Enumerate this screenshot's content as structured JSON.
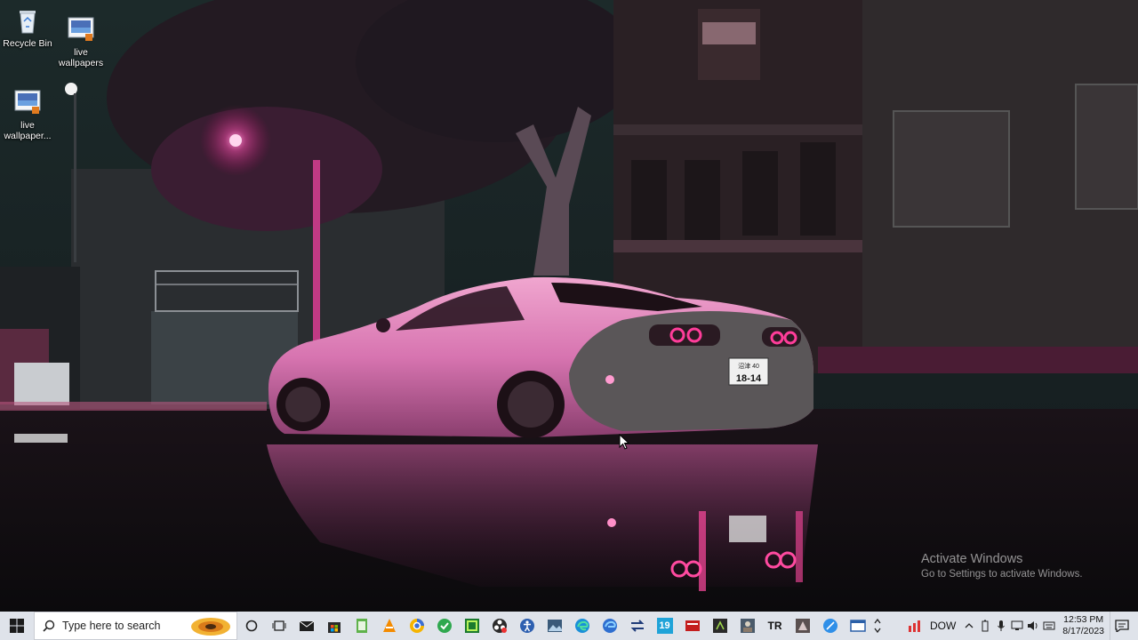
{
  "desktop": {
    "icons": [
      {
        "label": "Recycle Bin",
        "icon": "recycle-bin-icon"
      },
      {
        "label": "live wallpapers",
        "icon": "wallpaper-file-icon"
      },
      {
        "label": "live wallpaper...",
        "icon": "wallpaper-file-icon"
      }
    ],
    "plate": {
      "line1": "沼津 40",
      "line2": "18-14"
    }
  },
  "watermark": {
    "title": "Activate Windows",
    "subtitle": "Go to Settings to activate Windows."
  },
  "taskbar": {
    "search_placeholder": "Type here to search",
    "pinned": [
      "cortana-circle-icon",
      "task-view-icon",
      "mail-icon",
      "store-icon",
      "notepad-icon",
      "vlc-icon",
      "chrome-canary-icon",
      "green-app-icon",
      "camtasia-icon",
      "obs-icon",
      "accessibility-icon",
      "photos-icon",
      "edge-icon",
      "edge-beta-icon",
      "arrows-icon",
      "number-19-icon",
      "red-app-icon",
      "dark-app-icon",
      "picture-app-icon",
      "tr-app-icon",
      "game-app-icon",
      "blue-sphere-icon",
      "window-icon"
    ],
    "tr_label": "TR",
    "nineteen_label": "19",
    "tray": {
      "dow_label": "DOW",
      "time": "12:53 PM",
      "date": "8/17/2023"
    }
  },
  "colors": {
    "neon_pink": "#e85aa8",
    "car_pink": "#d97fb6",
    "taskbar_bg": "#dfe3ea"
  }
}
